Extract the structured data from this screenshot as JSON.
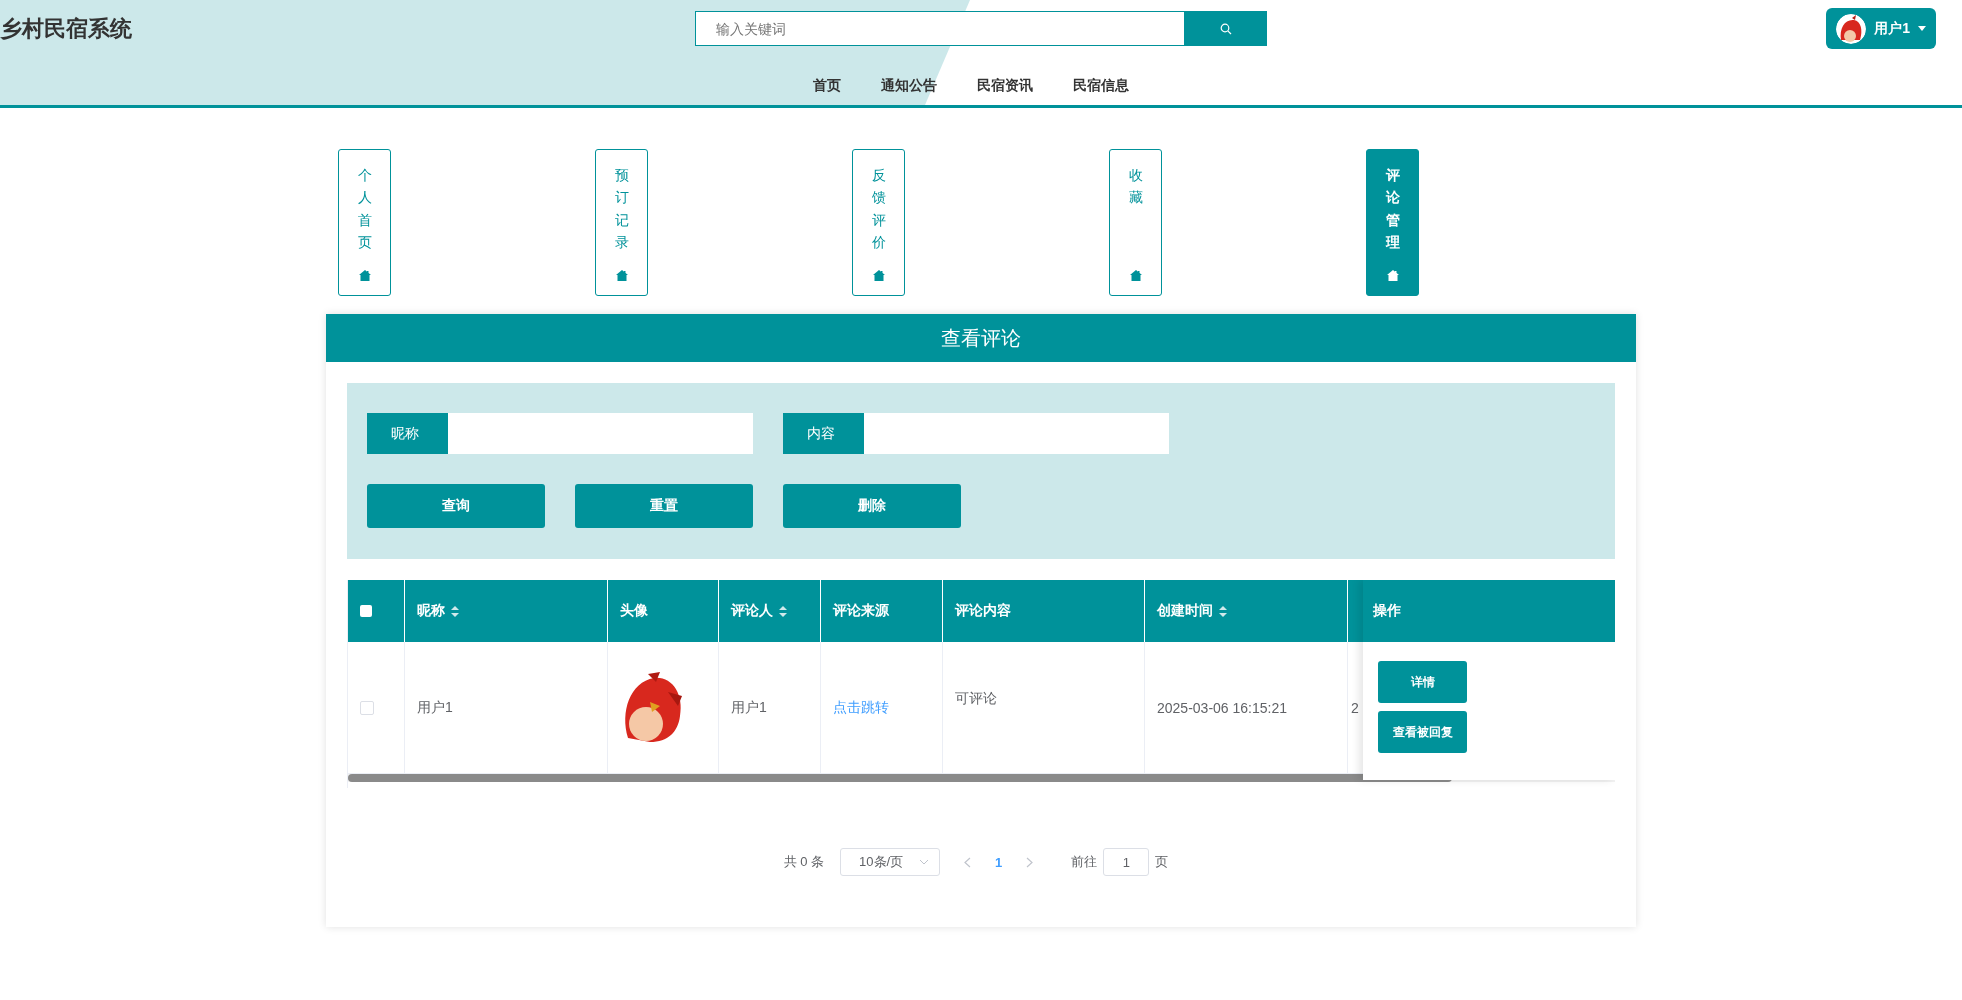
{
  "header": {
    "title": "乡村民宿系统",
    "search": {
      "placeholder": "输入关键词"
    },
    "user": {
      "name": "用户1"
    }
  },
  "nav": [
    {
      "label": "首页"
    },
    {
      "label": "通知公告"
    },
    {
      "label": "民宿资讯"
    },
    {
      "label": "民宿信息"
    }
  ],
  "tabs": [
    {
      "label": "个人首页",
      "selected": false
    },
    {
      "label": "预订记录",
      "selected": false
    },
    {
      "label": "反馈评价",
      "selected": false
    },
    {
      "label": "收藏",
      "selected": false
    },
    {
      "label": "评论管理",
      "selected": true
    }
  ],
  "panel": {
    "title": "查看评论",
    "filters": [
      {
        "label": "昵称"
      },
      {
        "label": "内容"
      }
    ],
    "buttons": [
      "查询",
      "重置",
      "删除"
    ],
    "table": {
      "select_all_checked": false,
      "columns": [
        {
          "label": "昵称",
          "sortable": true
        },
        {
          "label": "头像",
          "sortable": false
        },
        {
          "label": "评论人",
          "sortable": true
        },
        {
          "label": "评论来源",
          "sortable": false
        },
        {
          "label": "评论内容",
          "sortable": false
        },
        {
          "label": "创建时间",
          "sortable": true
        }
      ],
      "actions_label": "操作",
      "rows": [
        {
          "checked": false,
          "nickname": "用户1",
          "commenter": "用户1",
          "source": "点击跳转",
          "content": "可评论",
          "created": "2025-03-06 16:15:21",
          "column_8": "2",
          "actions": [
            "详情",
            "查看被回复"
          ]
        }
      ]
    },
    "pagination": {
      "total": "共 0 条",
      "page_size": "10条/页",
      "pages": [
        {
          "label": "1",
          "selected": true
        }
      ],
      "goto_label": "前往",
      "goto_value": "1",
      "goto_suffix": "页"
    }
  }
}
